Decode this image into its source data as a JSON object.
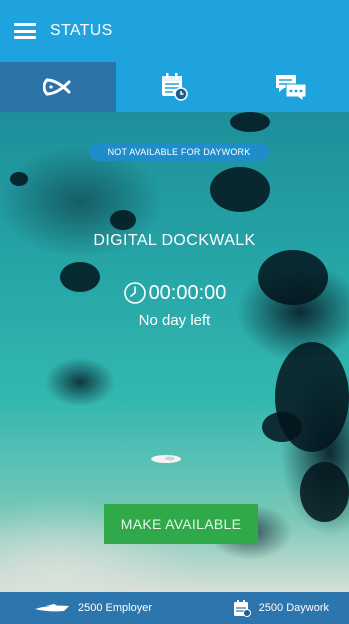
{
  "header": {
    "title": "STATUS",
    "menu_icon": "hamburger-menu-icon"
  },
  "tabs": [
    {
      "icon": "fish-logo-icon",
      "active": true
    },
    {
      "icon": "calendar-clock-icon",
      "active": false
    },
    {
      "icon": "chat-bubbles-icon",
      "active": false
    }
  ],
  "status": {
    "badge": "NOT AVAILABLE FOR DAYWORK",
    "heading": "DIGITAL DOCKWALK",
    "timer": "00:00:00",
    "timer_icon": "clock-icon",
    "subtext": "No day left",
    "action": "MAKE AVAILABLE"
  },
  "footer": {
    "employer": {
      "icon": "yacht-icon",
      "label": "2500 Employer"
    },
    "daywork": {
      "icon": "calendar-icon",
      "label": "2500 Daywork"
    }
  },
  "colors": {
    "header": "#1ea3df",
    "active_tab": "#2c73a8",
    "button": "#2fa94a",
    "footer": "#2d75ad"
  }
}
